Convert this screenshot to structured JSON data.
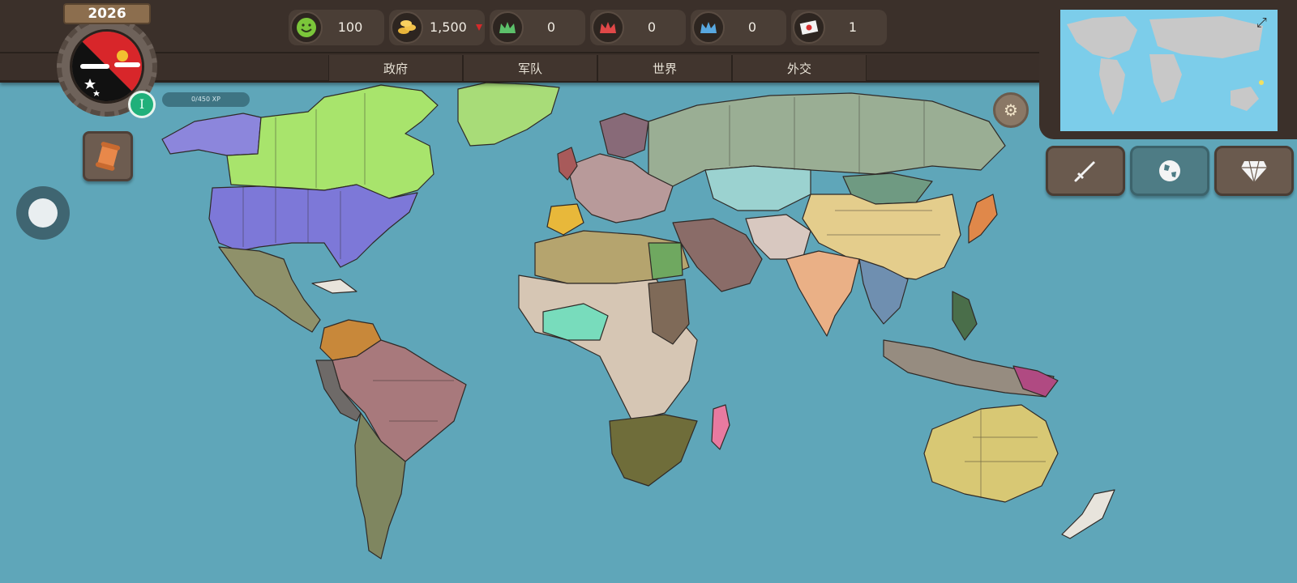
{
  "year": "2026",
  "player": {
    "level": "I",
    "xp": "0/450 XP"
  },
  "resources": [
    {
      "id": "stability",
      "value": "100",
      "icon": "smiley-icon"
    },
    {
      "id": "gold",
      "value": "1,500",
      "icon": "gold-coins-icon",
      "trend": "down"
    },
    {
      "id": "green-crown",
      "value": "0",
      "icon": "green-crown-icon"
    },
    {
      "id": "red-crown",
      "value": "0",
      "icon": "red-crown-icon"
    },
    {
      "id": "blue-crown",
      "value": "0",
      "icon": "blue-crown-icon"
    },
    {
      "id": "flags",
      "value": "1",
      "icon": "flag-card-icon"
    }
  ],
  "tabs": [
    {
      "label": "政府"
    },
    {
      "label": "军队"
    },
    {
      "label": "世界"
    },
    {
      "label": "外交"
    }
  ],
  "side_buttons": [
    {
      "icon": "sword-icon"
    },
    {
      "icon": "globe-icon",
      "active": true
    },
    {
      "icon": "diamond-icon"
    }
  ],
  "colors": {
    "ocean": "#5fa6b9",
    "panel": "#3b302a",
    "accent_green": "#20b07a",
    "minimap_ocean": "#7ccdea"
  }
}
